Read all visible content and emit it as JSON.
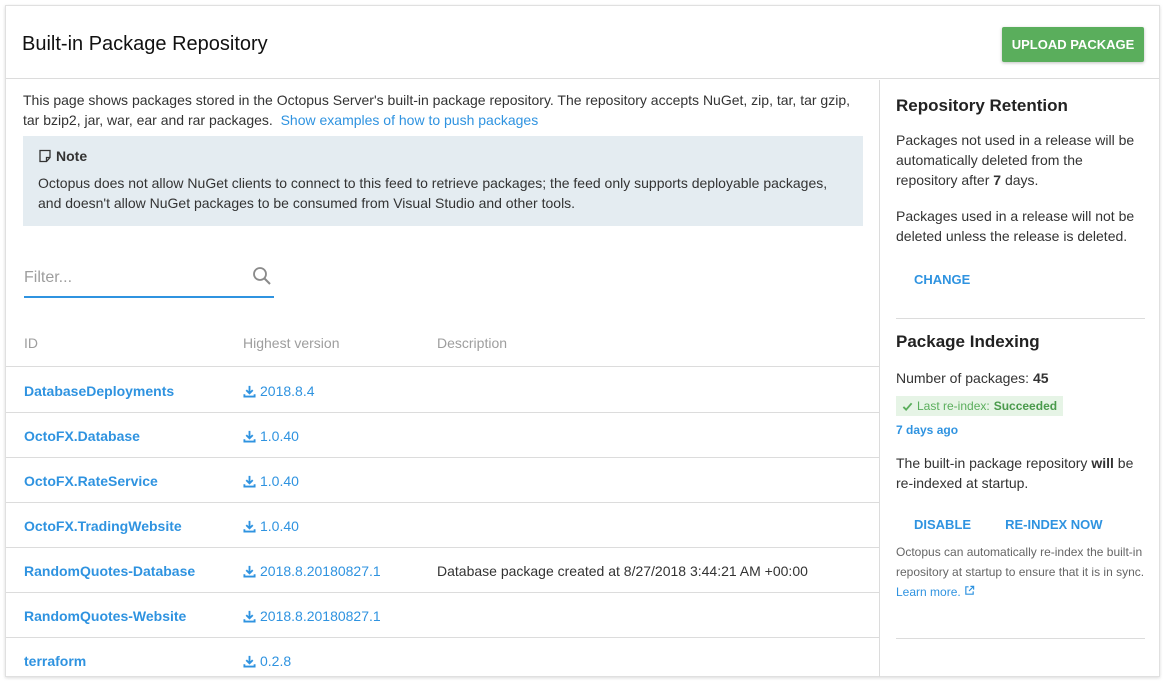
{
  "header": {
    "title": "Built-in Package Repository",
    "upload_label": "UPLOAD PACKAGE"
  },
  "intro": {
    "text": "This page shows packages stored in the Octopus Server's built-in package repository. The repository accepts NuGet, zip, tar, tar gzip, tar bzip2, jar, war, ear and rar packages.",
    "link": "Show examples of how to push packages"
  },
  "note": {
    "title": "Note",
    "text": "Octopus does not allow NuGet clients to connect to this feed to retrieve packages; the feed only supports deployable packages, and doesn't allow NuGet packages to be consumed from Visual Studio and other tools."
  },
  "filter": {
    "placeholder": "Filter..."
  },
  "table": {
    "columns": [
      "ID",
      "Highest version",
      "Description"
    ],
    "rows": [
      {
        "id": "DatabaseDeployments",
        "version": "2018.8.4",
        "description": ""
      },
      {
        "id": "OctoFX.Database",
        "version": "1.0.40",
        "description": ""
      },
      {
        "id": "OctoFX.RateService",
        "version": "1.0.40",
        "description": ""
      },
      {
        "id": "OctoFX.TradingWebsite",
        "version": "1.0.40",
        "description": ""
      },
      {
        "id": "RandomQuotes-Database",
        "version": "2018.8.20180827.1",
        "description": "Database package created at 8/27/2018 3:44:21 AM +00:00"
      },
      {
        "id": "RandomQuotes-Website",
        "version": "2018.8.20180827.1",
        "description": ""
      },
      {
        "id": "terraform",
        "version": "0.2.8",
        "description": ""
      }
    ]
  },
  "retention": {
    "title": "Repository Retention",
    "p1_prefix": "Packages not used in a release will be automatically deleted from the repository after ",
    "p1_days": "7",
    "p1_suffix": " days.",
    "p2": "Packages used in a release will not be deleted unless the release is deleted.",
    "change_label": "CHANGE"
  },
  "indexing": {
    "title": "Package Indexing",
    "count_label": "Number of packages: ",
    "count": "45",
    "last_reindex_label": "Last re-index: ",
    "last_reindex_status": "Succeeded",
    "last_reindex_time": "7 days ago",
    "startup_prefix": "The built-in package repository ",
    "startup_bold": "will",
    "startup_suffix": " be re-indexed at startup.",
    "disable_label": "DISABLE",
    "reindex_label": "RE-INDEX NOW",
    "help_text": "Octopus can automatically re-index the built-in repository at startup to ensure that it is in sync.",
    "learn_more": "Learn more."
  },
  "colors": {
    "accent": "#2f93e0",
    "success": "#5aae5c",
    "note_bg": "#e4ecf1"
  },
  "icons": [
    "note-icon",
    "search-icon",
    "download-icon",
    "check-icon",
    "external-link-icon"
  ]
}
